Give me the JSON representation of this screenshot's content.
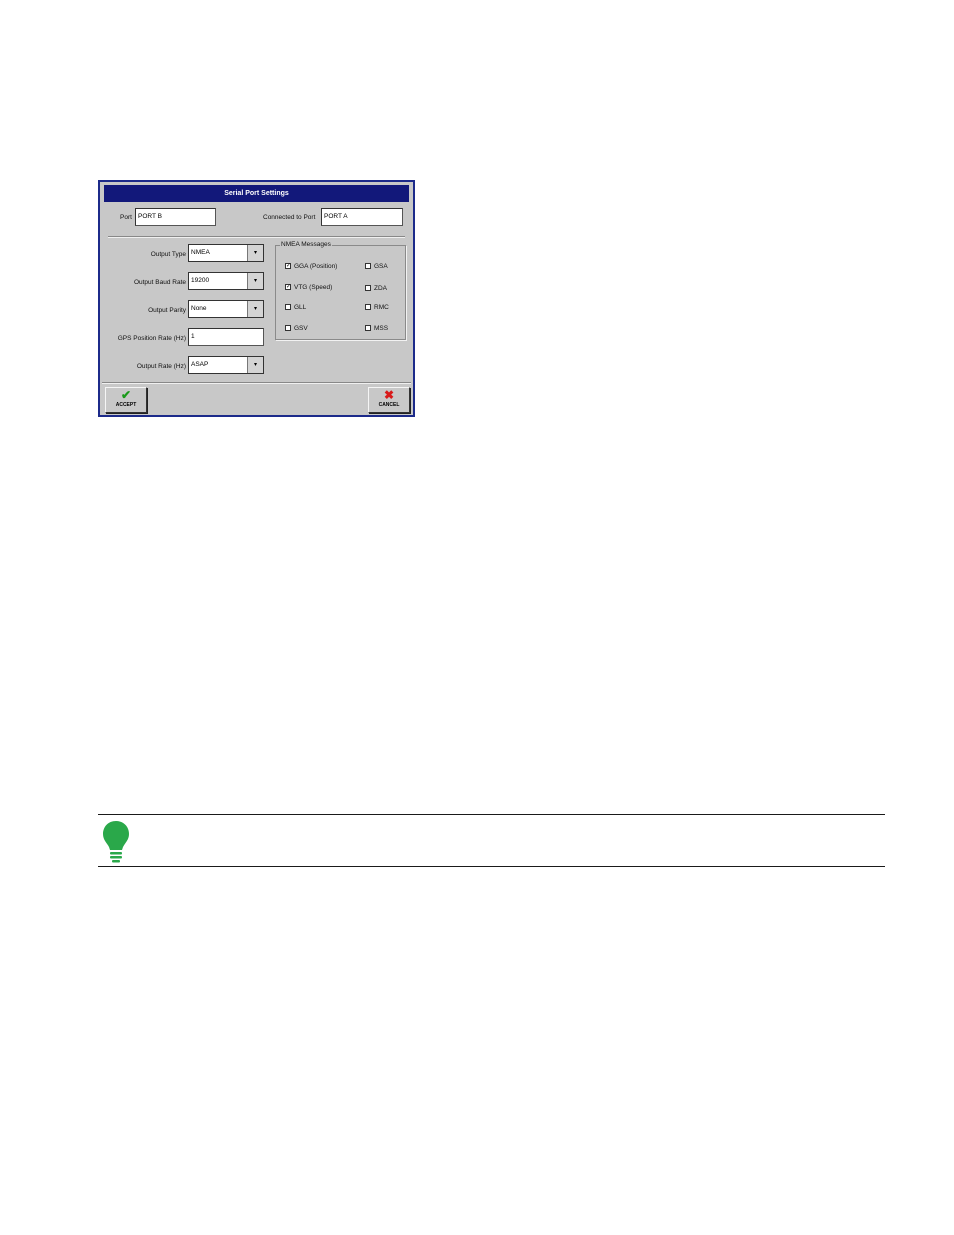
{
  "dialog": {
    "title": "Serial Port Settings",
    "port_label": "Port",
    "port_value": "PORT B",
    "connected_label": "Connected to Port",
    "connected_value": "PORT A",
    "output_type_label": "Output Type",
    "output_type_value": "NMEA",
    "baud_label": "Output Baud Rate",
    "baud_value": "19200",
    "parity_label": "Output Parity",
    "parity_value": "None",
    "gps_rate_label": "GPS Position Rate (Hz)",
    "gps_rate_value": "1",
    "output_rate_label": "Output Rate (Hz)",
    "output_rate_value": "ASAP",
    "nmea_title": "NMEA Messages",
    "messages": [
      {
        "label": "GGA (Position)",
        "checked": true
      },
      {
        "label": "GSA",
        "checked": false
      },
      {
        "label": "VTG (Speed)",
        "checked": true
      },
      {
        "label": "ZDA",
        "checked": false
      },
      {
        "label": "GLL",
        "checked": false
      },
      {
        "label": "RMC",
        "checked": false
      },
      {
        "label": "GSV",
        "checked": false
      },
      {
        "label": "MSS",
        "checked": false
      }
    ],
    "accept_label": "ACCEPT",
    "cancel_label": "CANCEL"
  },
  "colors": {
    "title_bar": "#12187a",
    "dialog_bg": "#c8c8c8",
    "accept_icon": "#1a9a1a",
    "cancel_icon": "#d81a1a",
    "bulb": "#2aa84a"
  },
  "icons": [
    "checkmark-icon",
    "x-icon",
    "lightbulb-icon",
    "dropdown-arrow-icon"
  ]
}
